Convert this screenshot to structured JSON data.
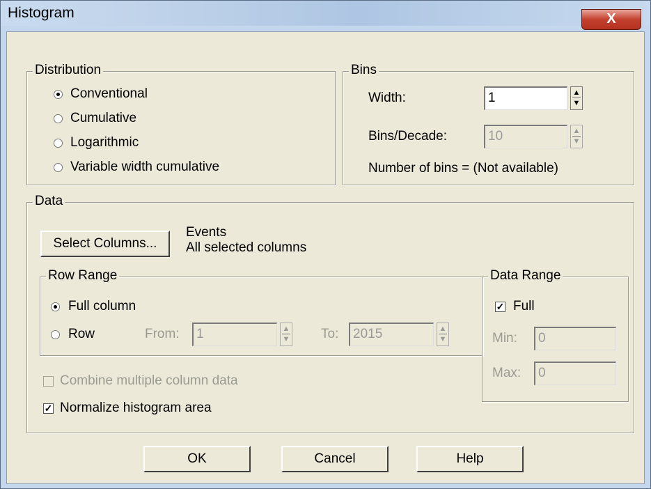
{
  "window": {
    "title": "Histogram",
    "close_label": "X"
  },
  "distribution": {
    "legend": "Distribution",
    "options": [
      {
        "label": "Conventional",
        "checked": true
      },
      {
        "label": "Cumulative",
        "checked": false
      },
      {
        "label": "Logarithmic",
        "checked": false
      },
      {
        "label": "Variable width cumulative",
        "checked": false
      }
    ]
  },
  "bins": {
    "legend": "Bins",
    "width_label": "Width:",
    "width_value": "1",
    "bins_decade_label": "Bins/Decade:",
    "bins_decade_value": "10",
    "number_of_bins": "Number of bins = (Not available)"
  },
  "data": {
    "legend": "Data",
    "select_columns_label": "Select Columns...",
    "events_text": "Events",
    "selected_text": "All selected columns",
    "row_range": {
      "legend": "Row Range",
      "full_column_label": "Full column",
      "row_label": "Row",
      "from_label": "From:",
      "from_value": "1",
      "to_label": "To:",
      "to_value": "2015"
    },
    "data_range": {
      "legend": "Data Range",
      "full_label": "Full",
      "full_checked": true,
      "min_label": "Min:",
      "min_value": "0",
      "max_label": "Max:",
      "max_value": "0"
    },
    "combine_label": "Combine multiple column data",
    "normalize_label": "Normalize histogram area",
    "normalize_checked": true
  },
  "buttons": {
    "ok": "OK",
    "cancel": "Cancel",
    "help": "Help"
  }
}
